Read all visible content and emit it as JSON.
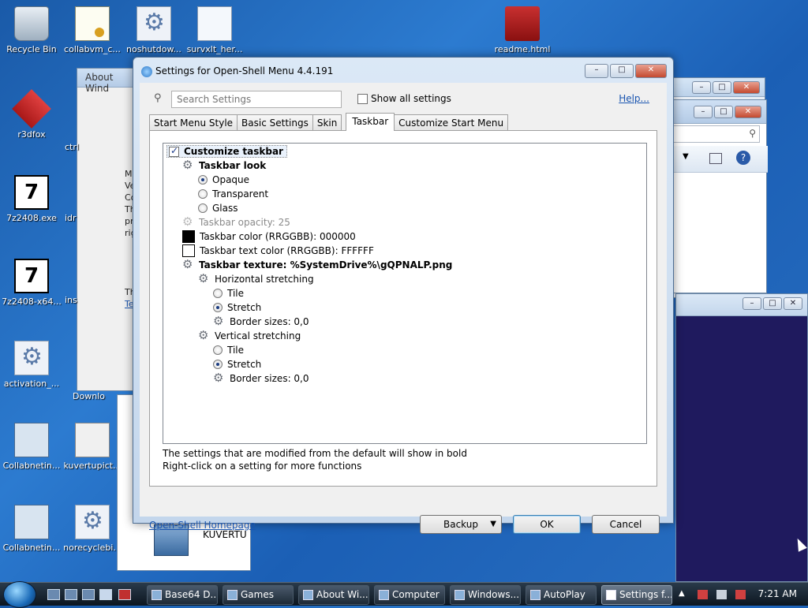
{
  "desktop_icons": [
    {
      "label": "Recycle Bin",
      "icon": "recycle-bin-icon"
    },
    {
      "label": "collabvm_c...",
      "icon": "certificate-icon"
    },
    {
      "label": "noshutdow...",
      "icon": "gear-file-icon"
    },
    {
      "label": "survxlt_her...",
      "icon": "documents-icon"
    },
    {
      "label": "readme.html",
      "icon": "red-file-icon"
    },
    {
      "label": "r3dfox",
      "icon": "red-fox-icon"
    },
    {
      "label": "7z2408.exe",
      "icon": "sevenzip-icon"
    },
    {
      "label": "7z2408-x64...",
      "icon": "sevenzip-icon"
    },
    {
      "label": "activation_...",
      "icon": "gear-file-icon"
    },
    {
      "label": "Collabnetin...",
      "icon": "network-computer-icon"
    },
    {
      "label": "kuvertupict...",
      "icon": "picture-icon"
    },
    {
      "label": "Collabnetin...",
      "icon": "network-computer-icon"
    },
    {
      "label": "norecyclebi...",
      "icon": "gear-file-icon"
    }
  ],
  "background": {
    "about_window_title": "About Wind",
    "about_fragments": [
      "Mi",
      "Ve",
      "Co",
      "Th",
      "pr",
      "rig",
      "Th",
      "Te"
    ],
    "partial_labels": [
      "ctrl",
      "idr",
      "ins",
      "Downlo"
    ],
    "explorer_item": "KUVERTU"
  },
  "dialog": {
    "title": "Settings for Open-Shell Menu 4.4.191",
    "search_placeholder": "Search Settings",
    "show_all_label": "Show all settings",
    "help_label": "Help...",
    "tabs": [
      "Start Menu Style",
      "Basic Settings",
      "Skin",
      "Taskbar",
      "Customize Start Menu"
    ],
    "active_tab": 3,
    "tree": {
      "customize_taskbar": "Customize taskbar",
      "taskbar_look": "Taskbar look",
      "opaque": "Opaque",
      "transparent": "Transparent",
      "glass": "Glass",
      "opacity": "Taskbar opacity: 25",
      "color": "Taskbar color (RRGGBB): 000000",
      "text_color": "Taskbar text color (RRGGBB): FFFFFF",
      "texture": "Taskbar texture: %SystemDrive%\\gQPNALP.png",
      "horizontal": "Horizontal stretching",
      "vertical": "Vertical stretching",
      "tile": "Tile",
      "stretch": "Stretch",
      "border_sizes": "Border sizes: 0,0"
    },
    "colors": {
      "taskbar_color": "#000000",
      "taskbar_text_color": "#FFFFFF"
    },
    "hint_line1": "The settings that are modified from the default will show in bold",
    "hint_line2": "Right-click on a setting for more functions",
    "homepage_label": "Open-Shell Homepage",
    "backup_label": "Backup",
    "ok_label": "OK",
    "cancel_label": "Cancel"
  },
  "taskbar": {
    "items": [
      "Base64 D...",
      "Games",
      "About Wi...",
      "Computer",
      "Windows...",
      "AutoPlay",
      "Settings f..."
    ],
    "active_index": 6,
    "clock": "7:21 AM"
  }
}
